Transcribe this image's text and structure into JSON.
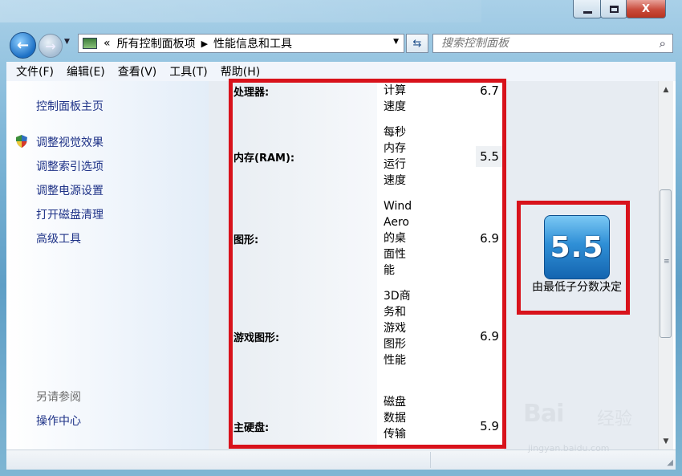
{
  "window": {
    "min_label": "",
    "close_label": "X"
  },
  "nav": {
    "back_icon": "back-arrow-icon",
    "forward_icon": "forward-arrow-icon"
  },
  "address": {
    "prefix": "«",
    "crumb1": "所有控制面板项",
    "crumb2": "性能信息和工具"
  },
  "search": {
    "placeholder": "搜索控制面板"
  },
  "menu": [
    "文件(F)",
    "编辑(E)",
    "查看(V)",
    "工具(T)",
    "帮助(H)"
  ],
  "sidebar": {
    "home": "控制面板主页",
    "links": [
      "调整视觉效果",
      "调整索引选项",
      "调整电源设置",
      "打开磁盘清理",
      "高级工具"
    ],
    "see_also_title": "另请参阅",
    "see_also_links": [
      "操作中心"
    ]
  },
  "scores": [
    {
      "label": "处理器:",
      "desc": "计算速度",
      "score": "6.7"
    },
    {
      "label": "内存(RAM):",
      "desc": "每秒内存运行速度",
      "score": "5.5"
    },
    {
      "label": "图形:",
      "desc": "WindAero的桌面性能",
      "score": "6.9"
    },
    {
      "label": "游戏图形:",
      "desc": "3D商务和游戏图形性能",
      "score": "6.9"
    },
    {
      "label": "主硬盘:",
      "desc": "磁盘数据传输",
      "score": "5.9"
    }
  ],
  "base_score": {
    "value": "5.5",
    "caption": "由最低子分数决定"
  },
  "watermark": {
    "brand": "Bai",
    "brand2": "经验",
    "url": "jingyan.baidu.com"
  },
  "colors": {
    "highlight_red": "#d8121b",
    "link_blue": "#1e3287"
  }
}
